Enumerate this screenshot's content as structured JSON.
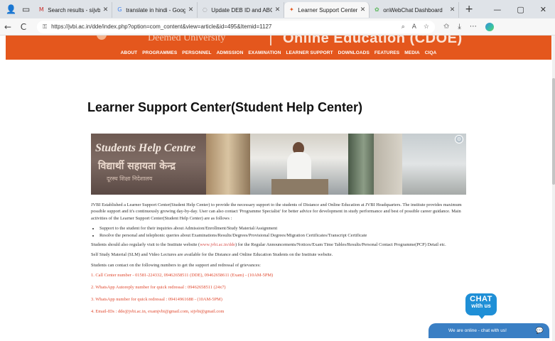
{
  "browser": {
    "tabs": [
      {
        "title": "Search results - sijvbi@gmai",
        "favicon": "M",
        "favicon_color": "#c9302c",
        "close": "✕"
      },
      {
        "title": "translate in hindi - Google Se",
        "favicon": "G",
        "favicon_color": "#4285f4",
        "close": "✕"
      },
      {
        "title": "Update DEB ID and ABC ID",
        "favicon": "◌",
        "favicon_color": "#777777",
        "close": "✕"
      },
      {
        "title": "Learner Support Center(Stud",
        "favicon": "✦",
        "favicon_color": "#e4571d",
        "close": "✕"
      },
      {
        "title": "onWebChat Dashboard",
        "favicon": "✿",
        "favicon_color": "#5cb85c",
        "close": "✕"
      }
    ],
    "active_tab_index": 3,
    "url": "https://jvbi.ac.in/dde/index.php?option=com_content&view=article&id=495&Itemid=1127",
    "icons": {
      "back": "←",
      "reload": "C",
      "lock": "⚿",
      "new_tab": "+",
      "minimize": "—",
      "restore": "▢",
      "close": "✕"
    }
  },
  "site": {
    "banner": {
      "university": "Deemed University",
      "title": "Online Education (CDOE)"
    },
    "nav": [
      "ABOUT",
      "PROGRAMMES",
      "PERSONNEL",
      "ADMISSION",
      "EXAMINATION",
      "LEARNER SUPPORT",
      "DOWNLOADS",
      "FEATURES",
      "MEDIA",
      "CIQA"
    ],
    "page_title": "Learner Support Center(Student Help Center)",
    "hero": {
      "en": "Students Help Centre",
      "hi": "विद्यार्थी सहायता केन्द्र",
      "hi2": "दूरस्थ शिक्षा निदेशालय"
    },
    "intro": "JVBI Established a Learner Support Center(Student Help Center) to provide the necessary support to the students of Distance and Online Education at JVBI Headquarters. The institute provides maximum possible support and it's continuously growing day-by-day. User can also contact 'Programme Specialist' for better advice for development in study performance and best of possible career guidance. Main activities of the Learner Support Center(Student Help Center) are as follows :",
    "activities": [
      "Support to the student for their inquiries about Admission/Enrollment/Study Material/Assignment",
      "Resolve the personal and telephonic queries about Examinations/Results/Degrees/Provisional Degrees/Migration Certificates/Transcript Certificate"
    ],
    "visit_pre": "Students should also regularly visit to the Institute website (",
    "visit_link": "www.jvbi.ac.in/dde",
    "visit_post": ") for the Regular Announcements/Notices/Exam Time Tables/Results/Personal Contact Programme(PCP) Detail etc.",
    "slm": "Self Study Material (SLM) and Video Lectures are available for the Distance and Online Education Students on the Institute website.",
    "contact_intro": "Students can contact on the following numbers to get the support and redressal of grievances:",
    "contacts": [
      "1. Call Center number - 01581-224332, 09462658511 (DDE), 09462658611 (Exam) - (10AM-5PM)",
      "2. WhatsApp Autoreply number for quick redressal : 09462658511 (24x7)",
      "3. WhatsApp number for quick redressal : 09414961688 - (10AM-5PM)",
      "4. Email-IDs : dde@jvbi.ac.in, examjvbi@gmail.com, sijvbi@gmail.com"
    ]
  },
  "chat": {
    "badge_line1": "CHAT",
    "badge_line2": "with us",
    "bar_text": "We are online - chat with us!",
    "icon": "chat-bubble-icon"
  },
  "colors": {
    "brand_orange": "#e4571d",
    "chat_blue": "#3a7fc4",
    "contact_red": "#e0492f"
  }
}
